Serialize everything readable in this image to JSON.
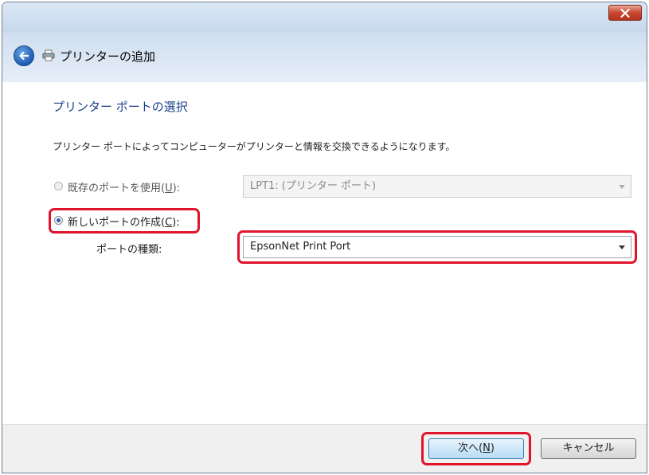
{
  "dialog": {
    "title": "プリンターの追加",
    "section_title": "プリンター ポートの選択",
    "description": "プリンター ポートによってコンピューターがプリンターと情報を交換できるようになります。"
  },
  "existing_port": {
    "label_prefix": "既存のポートを使用(",
    "label_key": "U",
    "label_suffix": "):",
    "selected": false,
    "combo_value": "LPT1: (プリンター ポート)"
  },
  "new_port": {
    "label_prefix": "新しいポートの作成(",
    "label_key": "C",
    "label_suffix": "):",
    "selected": true,
    "type_label": "ポートの種類:",
    "combo_value": "EpsonNet Print Port"
  },
  "buttons": {
    "next_prefix": "次へ(",
    "next_key": "N",
    "next_suffix": ")",
    "cancel": "キャンセル"
  },
  "colors": {
    "highlight": "#e0142d",
    "section_title": "#1a3f8a"
  },
  "icons": [
    "close-icon",
    "back-arrow-icon",
    "printer-icon",
    "dropdown-arrow-icon"
  ]
}
